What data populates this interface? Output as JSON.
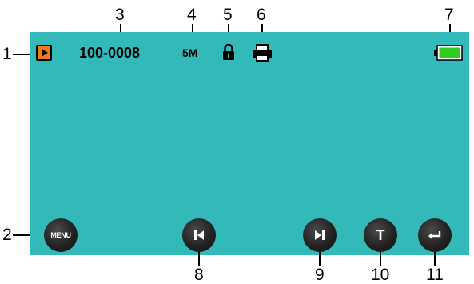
{
  "callouts": {
    "c1": "1",
    "c2": "2",
    "c3": "3",
    "c4": "4",
    "c5": "5",
    "c6": "6",
    "c7": "7",
    "c8": "8",
    "c9": "9",
    "c10": "10",
    "c11": "11"
  },
  "status_bar": {
    "file_number": "100-0008",
    "resolution": "5M",
    "icons": [
      "playback-mode-icon",
      "lock-icon",
      "print-icon",
      "battery-icon"
    ]
  },
  "buttons": {
    "menu_label": "MENU",
    "t_label": "T",
    "prev_icon": "previous-icon",
    "next_icon": "next-icon",
    "return_icon": "return-icon"
  },
  "colors": {
    "screen": "#33b9b9",
    "playback_icon": "#f07a1a",
    "battery": "#2ecc1f",
    "button": "#222222"
  }
}
